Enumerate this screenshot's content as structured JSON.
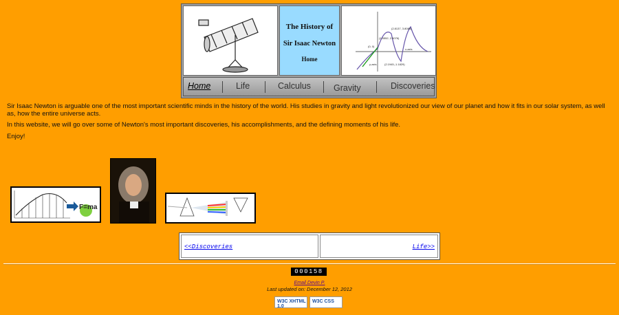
{
  "header": {
    "title_line1": "The History of",
    "title_line2": "Sir Isaac Newton",
    "home_label": "Home",
    "graph_labels": [
      "(1.5552, 2.5076)",
      "(2.8137, 3.8085)",
      "(0, 0)",
      "(2.1945,-1.1829)",
      "x-axis",
      "y-axis"
    ]
  },
  "nav": {
    "items": [
      {
        "label": "Home",
        "active": true
      },
      {
        "label": "Life",
        "active": false
      },
      {
        "label": "Calculus",
        "active": false
      },
      {
        "label": "Gravity",
        "active": false
      },
      {
        "label": "Discoveries",
        "active": false
      }
    ]
  },
  "content": {
    "paragraph1": "Sir Isaac Newton is arguable one of the most important scientific minds in the history of the world. His studies in gravity and light revolutionized our view of our planet and how it fits in our solar system, as well as, how the entire universe acts.",
    "paragraph2": "In this website, we will go over some of Newton's most important discoveries, his accomplishments, and the defining moments of his life.",
    "paragraph3": "Enjoy!",
    "fma_label": "F=ma"
  },
  "pager": {
    "prev_label": "<<Discoveries",
    "next_label": "Life>>"
  },
  "footer": {
    "counter": "000158",
    "email_label": "Email Devin P.",
    "updated": "Last updated on: December 12, 2012",
    "badge_xhtml": "W3C XHTML 1.0",
    "badge_css": "W3C CSS"
  },
  "colors": {
    "background": "#ff9e00",
    "title_cell": "#99dbff",
    "link": "#0000ee"
  }
}
